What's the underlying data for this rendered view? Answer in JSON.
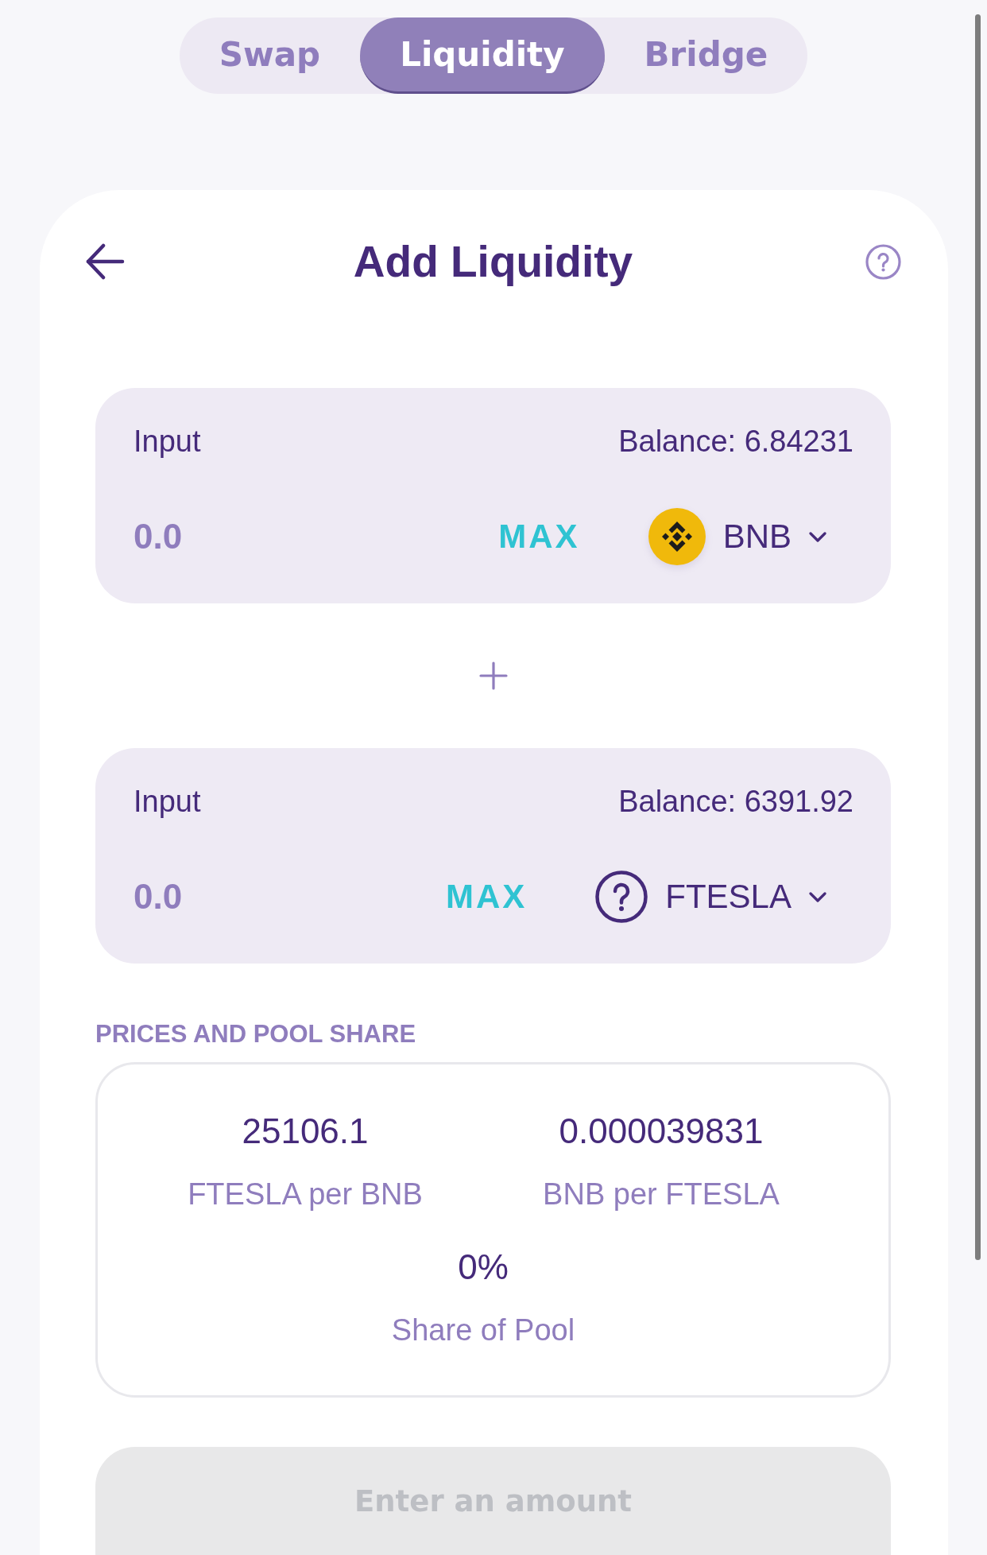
{
  "tabs": [
    {
      "label": "Swap",
      "selected": false
    },
    {
      "label": "Liquidity",
      "selected": true
    },
    {
      "label": "Bridge",
      "selected": false
    }
  ],
  "header": {
    "title": "Add Liquidity"
  },
  "inputs": [
    {
      "label": "Input",
      "balance": "Balance: 6.84231",
      "placeholder": "0.0",
      "max": "MAX",
      "token": {
        "symbol": "BNB",
        "kind": "bnb"
      }
    },
    {
      "label": "Input",
      "balance": "Balance: 6391.92",
      "placeholder": "0.0",
      "max": "MAX",
      "token": {
        "symbol": "FTESLA",
        "kind": "unknown"
      }
    }
  ],
  "prices": {
    "title": "PRICES AND POOL SHARE",
    "items": [
      {
        "value": "25106.1",
        "label": "FTESLA per BNB"
      },
      {
        "value": "0.000039831",
        "label": "BNB per FTESLA"
      },
      {
        "value": "0%",
        "label": "Share of Pool"
      }
    ]
  },
  "submit": {
    "label": "Enter an amount",
    "disabled": true
  }
}
